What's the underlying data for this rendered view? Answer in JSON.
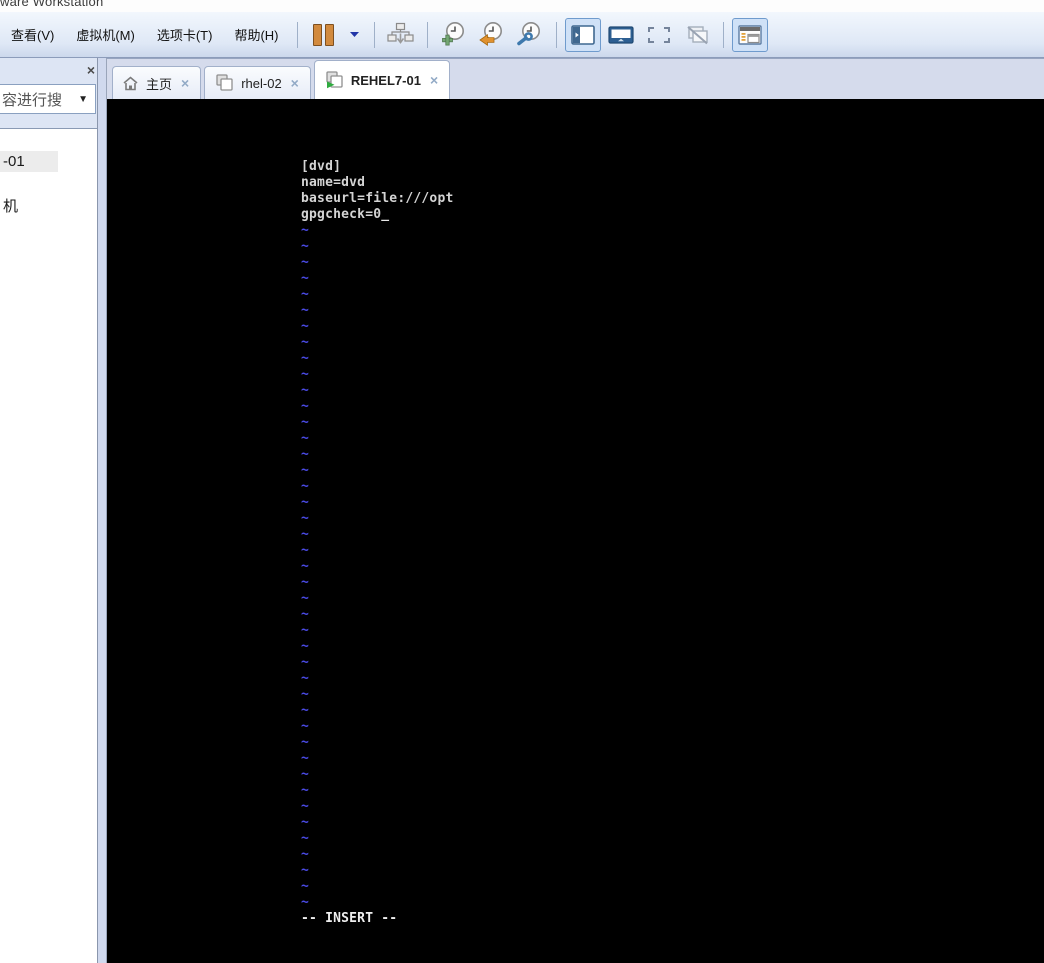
{
  "window": {
    "title": "ware Workstation"
  },
  "menubar": {
    "items": [
      {
        "label": "查看(V)"
      },
      {
        "label": "虚拟机(M)"
      },
      {
        "label": "选项卡(T)"
      },
      {
        "label": "帮助(H)"
      }
    ]
  },
  "toolbar": {
    "buttons": [
      {
        "id": "suspend",
        "icon": "pause-icon",
        "state": "normal"
      },
      {
        "id": "suspend-dropdown",
        "icon": "chevron-down-icon",
        "state": "normal"
      },
      {
        "id": "send-ctrl-alt-del",
        "icon": "devices-down-arrow-icon",
        "state": "normal"
      },
      {
        "id": "take-snapshot",
        "icon": "clock-plus-icon",
        "state": "normal"
      },
      {
        "id": "revert-snapshot",
        "icon": "clock-back-arrow-icon",
        "state": "normal"
      },
      {
        "id": "snapshot-manager",
        "icon": "clock-wrench-icon",
        "state": "normal"
      },
      {
        "id": "show-library",
        "icon": "library-panel-icon",
        "state": "checked"
      },
      {
        "id": "console-view",
        "icon": "console-monitor-icon",
        "state": "normal"
      },
      {
        "id": "fullscreen",
        "icon": "fullscreen-brackets-icon",
        "state": "normal"
      },
      {
        "id": "unity-mode",
        "icon": "unity-slash-icon",
        "state": "disabled"
      },
      {
        "id": "show-thumbnail-bar",
        "icon": "thumbnail-window-icon",
        "state": "checked"
      }
    ]
  },
  "tabbar": {
    "close_glyph": "×",
    "tabs": [
      {
        "label": "主页",
        "icon": "home",
        "active": false
      },
      {
        "label": "rhel-02",
        "icon": "vm",
        "active": false
      },
      {
        "label": "REHEL7-01",
        "icon": "vm-running",
        "active": true
      }
    ]
  },
  "sidebar": {
    "close_glyph": "×",
    "search_value": "容进行搜",
    "dropdown_glyph": "▼",
    "items": [
      {
        "label": "-01",
        "selected": true
      },
      {
        "label": "机",
        "selected": false
      }
    ]
  },
  "terminal": {
    "lines": [
      "[dvd]",
      "name=dvd",
      "baseurl=file:///opt",
      "gpgcheck=0"
    ],
    "cursor_glyph": "_",
    "tilde_glyph": "~",
    "tilde_count": 43,
    "status_text": "-- INSERT --",
    "colors": {
      "background": "#000000",
      "foreground": "#d4d4d4",
      "tilde": "#4a4ae6",
      "status": "#eeeeee"
    }
  },
  "colors": {
    "menubar_gradient_top": "#f2f7fd",
    "menubar_gradient_bottom": "#ccd8ec",
    "tabstrip_background": "#d5dbec",
    "active_tab_background": "#ffffff",
    "toolbar_checked_background": "#cfe1f7",
    "toolbar_checked_border": "#6f9bcd",
    "pause_orange": "#d28a3e",
    "selection_gray": "#ececec"
  }
}
